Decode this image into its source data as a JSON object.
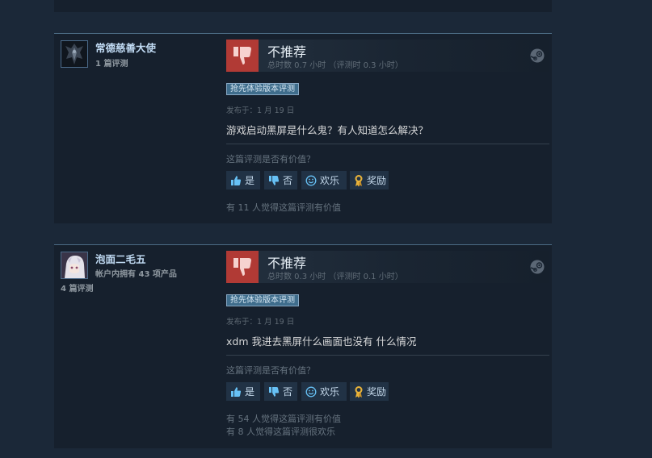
{
  "reviews": [
    {
      "author": {
        "name": "常德慈善大使",
        "meta": "1 篇评测",
        "extra": ""
      },
      "verdict": {
        "title": "不推荐",
        "playtime": "总时数 0.7 小时  （评测时 0.3 小时）"
      },
      "badge": "抢先体验版本评测",
      "posted": "发布于：1 月 19 日",
      "text": "游戏启动黑屏是什么鬼？有人知道怎么解决？",
      "helpful_question": "这篇评测是否有价值？",
      "buttons": {
        "yes": "是",
        "no": "否",
        "funny": "欢乐",
        "award": "奖励"
      },
      "results": [
        "有 11 人觉得这篇评测有价值"
      ]
    },
    {
      "author": {
        "name": "泡面二毛五",
        "meta": "帐户内拥有 43 项产品",
        "extra": "4 篇评测"
      },
      "verdict": {
        "title": "不推荐",
        "playtime": "总时数 0.3 小时  （评测时 0.1 小时）"
      },
      "badge": "抢先体验版本评测",
      "posted": "发布于：1 月 19 日",
      "text": "xdm 我进去黑屏什么画面也没有 什么情况",
      "helpful_question": "这篇评测是否有价值？",
      "buttons": {
        "yes": "是",
        "no": "否",
        "funny": "欢乐",
        "award": "奖励"
      },
      "results": [
        "有 54 人觉得这篇评测有价值",
        "有 8 人觉得这篇评测很欢乐"
      ]
    }
  ],
  "icons": {
    "verdict": "thumbs-down-icon",
    "platform": "steam-logo-icon",
    "yes": "thumbs-up-icon",
    "no": "thumbs-down-icon",
    "funny": "smiley-icon",
    "award": "award-ribbon-icon"
  },
  "colors": {
    "page_bg": "#1b2838",
    "card_bg": "#16202d",
    "not_recommended": "#b13a35",
    "author_name": "#c1dbf4",
    "badge_bg": "#3f6d8c",
    "award_gold": "#e8b33a"
  }
}
